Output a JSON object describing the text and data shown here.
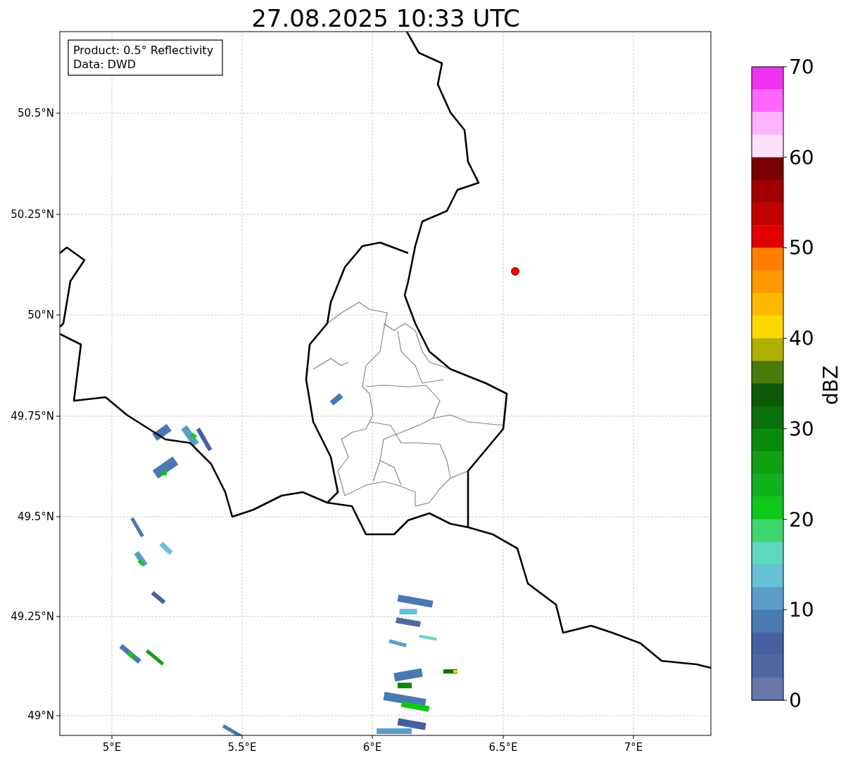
{
  "title": "27.08.2025 10:33 UTC",
  "info_box": [
    "Product: 0.5° Reflectivity",
    "Data: DWD"
  ],
  "x_ticks": [
    "5°E",
    "5.5°E",
    "6°E",
    "6.5°E",
    "7°E"
  ],
  "y_ticks": [
    "50.5°N",
    "50.25°N",
    "50°N",
    "49.75°N",
    "49.5°N",
    "49.25°N",
    "49°N"
  ],
  "colorbar": {
    "label": "dBZ",
    "ticks": [
      "70",
      "60",
      "50",
      "40",
      "30",
      "20",
      "10",
      "0"
    ],
    "segments": [
      {
        "color": "#ee33ee"
      },
      {
        "color": "#ff66ff"
      },
      {
        "color": "#ffb3ff"
      },
      {
        "color": "#ffe0ff"
      },
      {
        "color": "#7a0000"
      },
      {
        "color": "#a00000"
      },
      {
        "color": "#c00000"
      },
      {
        "color": "#e00000"
      },
      {
        "color": "#ff8000"
      },
      {
        "color": "#ff9900"
      },
      {
        "color": "#ffb800"
      },
      {
        "color": "#ffd700"
      },
      {
        "color": "#b0b000"
      },
      {
        "color": "#4a7a0a"
      },
      {
        "color": "#0a5a0a"
      },
      {
        "color": "#0a700a"
      },
      {
        "color": "#0a8a0a"
      },
      {
        "color": "#10a010"
      },
      {
        "color": "#10b020"
      },
      {
        "color": "#10c818"
      },
      {
        "color": "#3ed66a"
      },
      {
        "color": "#60d6c0"
      },
      {
        "color": "#66c0d8"
      },
      {
        "color": "#5a9ec8"
      },
      {
        "color": "#4a78b0"
      },
      {
        "color": "#4460a0"
      },
      {
        "color": "#5068a0"
      },
      {
        "color": "#6577aa"
      }
    ]
  }
}
